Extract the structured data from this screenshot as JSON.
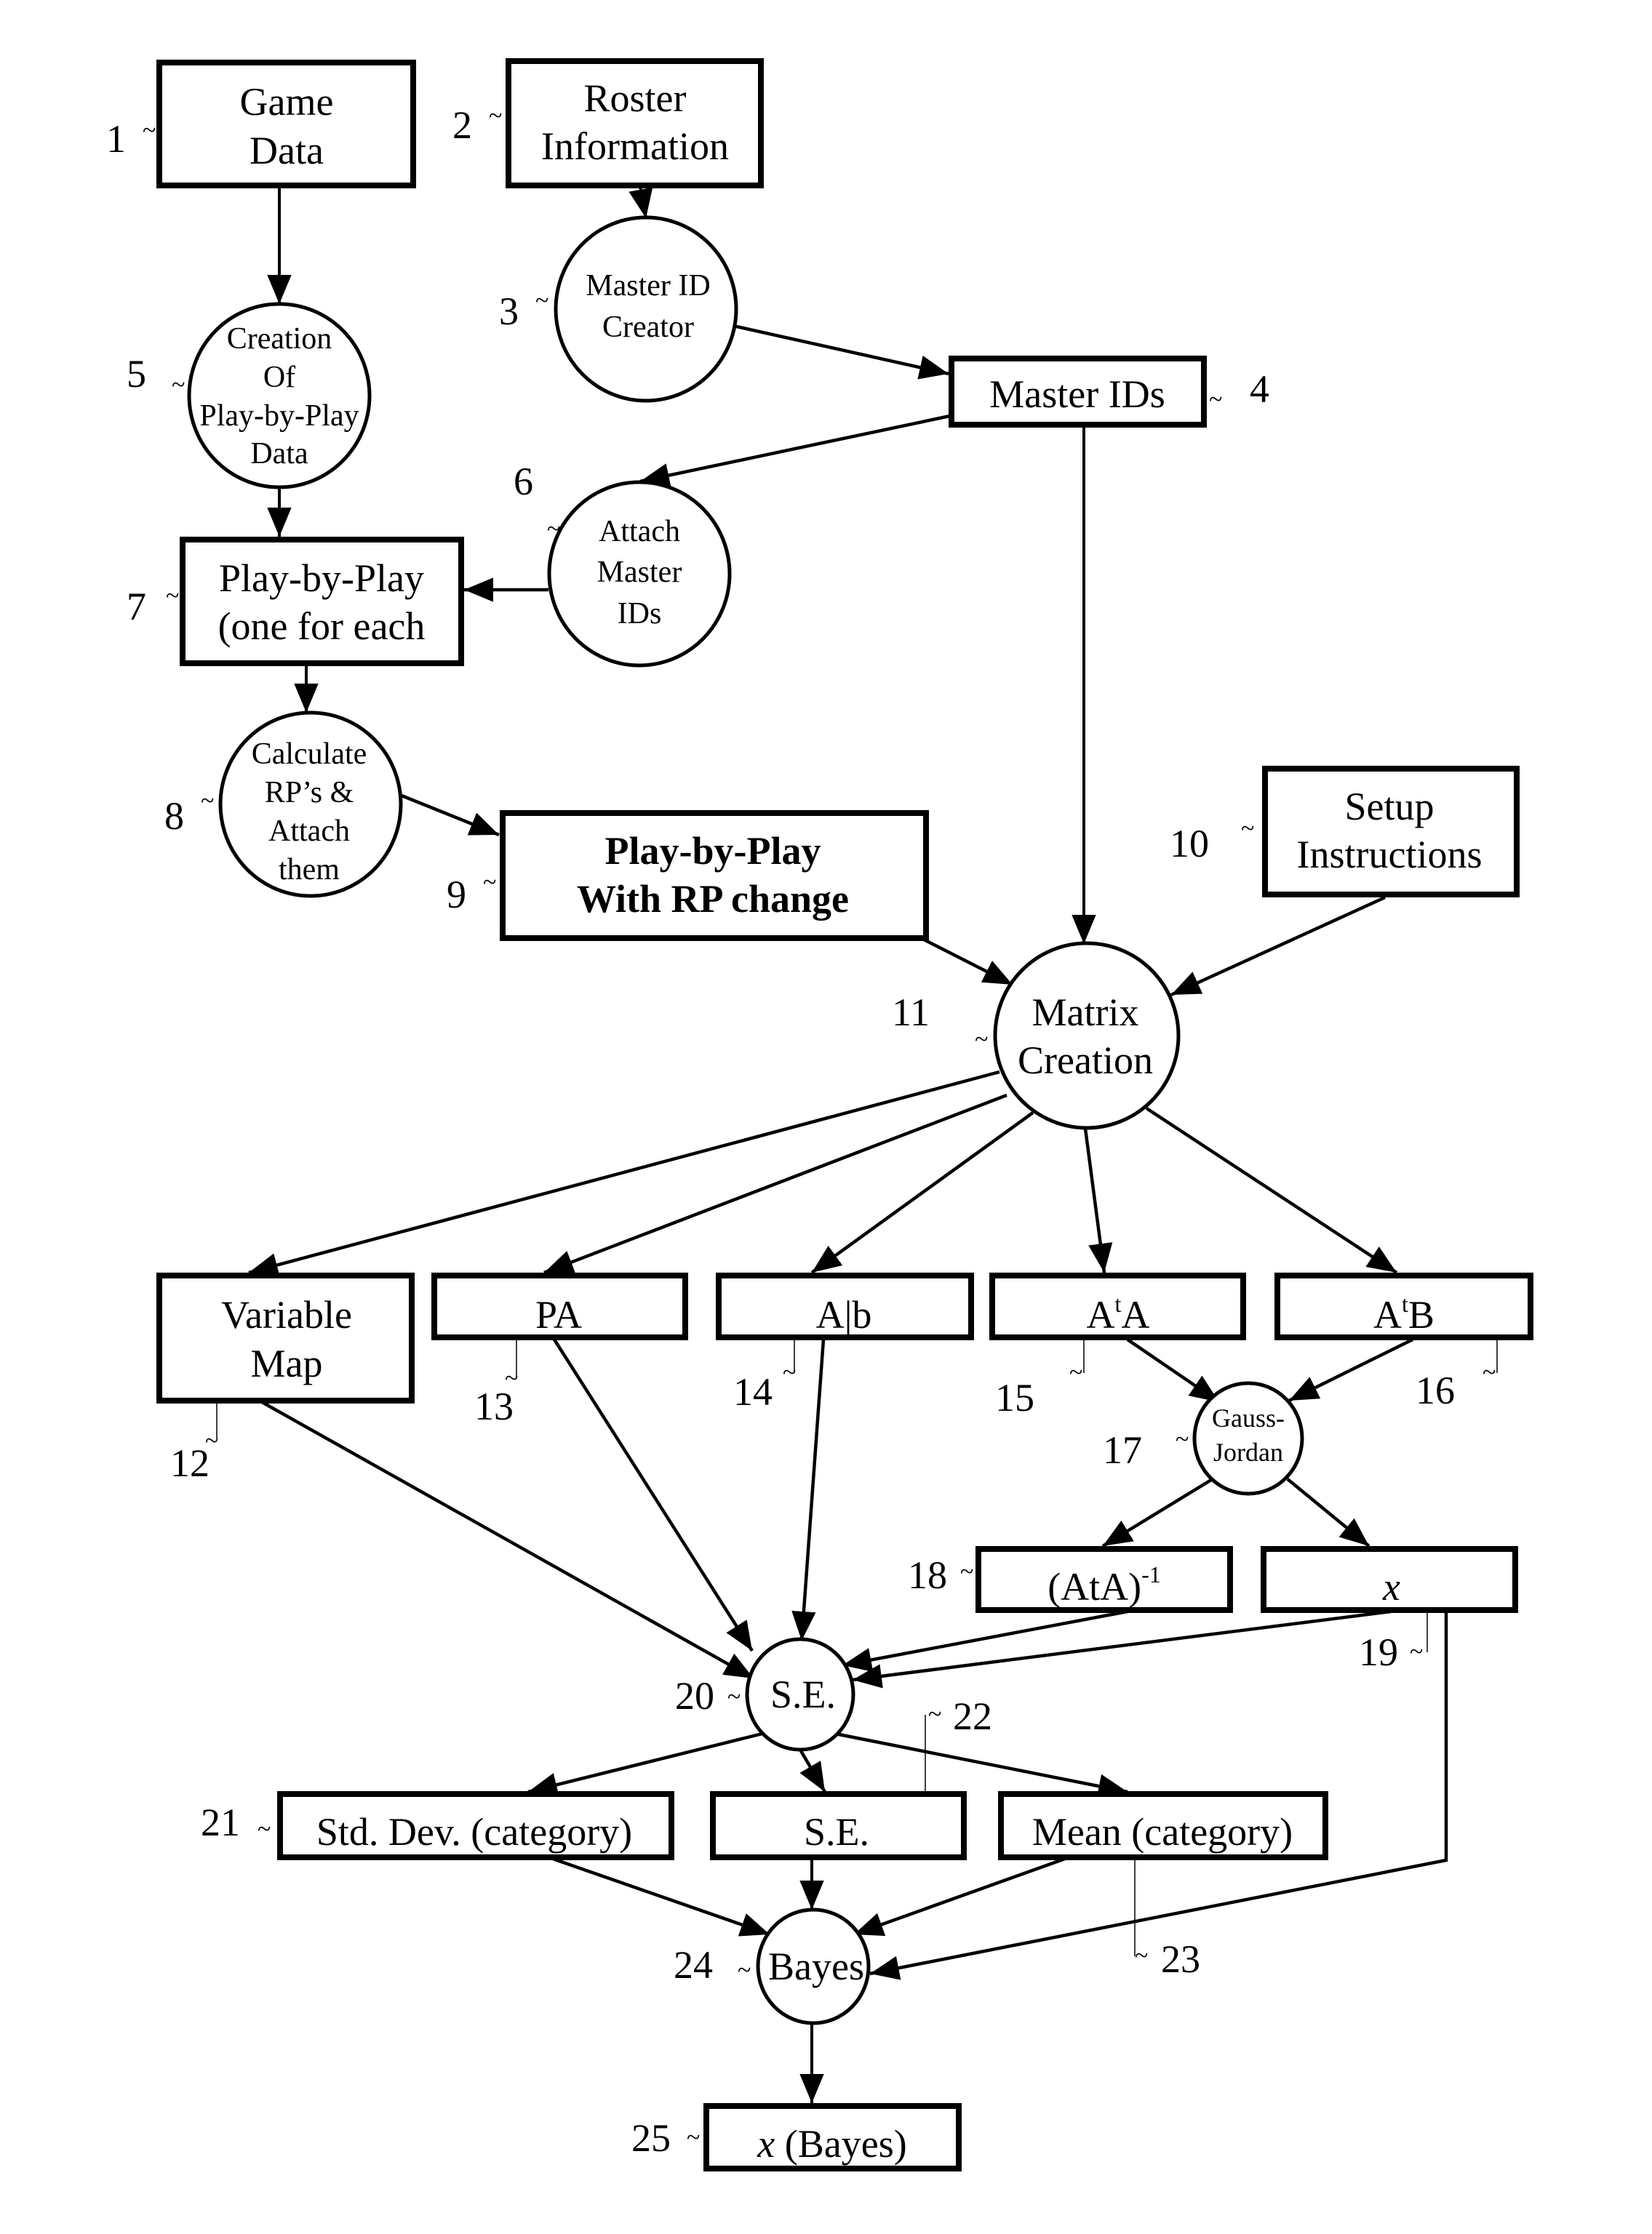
{
  "diagram": {
    "type": "flowchart",
    "colors": {
      "stroke": "#000000",
      "background": "#ffffff"
    },
    "nodes": [
      {
        "id": 1,
        "shape": "box",
        "lines": [
          "Game",
          "Data"
        ]
      },
      {
        "id": 2,
        "shape": "box",
        "lines": [
          "Roster",
          "Information"
        ]
      },
      {
        "id": 3,
        "shape": "circle",
        "lines": [
          "Master ID",
          "Creator"
        ]
      },
      {
        "id": 4,
        "shape": "box",
        "lines": [
          "Master IDs"
        ]
      },
      {
        "id": 5,
        "shape": "circle",
        "lines": [
          "Creation",
          "Of",
          "Play-by-Play",
          "Data"
        ]
      },
      {
        "id": 6,
        "shape": "circle",
        "lines": [
          "Attach",
          "Master",
          "IDs"
        ]
      },
      {
        "id": 7,
        "shape": "box",
        "lines": [
          "Play-by-Play",
          "(one for each"
        ]
      },
      {
        "id": 8,
        "shape": "circle",
        "lines": [
          "Calculate",
          "RP’s &",
          "Attach",
          "them"
        ]
      },
      {
        "id": 9,
        "shape": "box",
        "bold": true,
        "lines": [
          "Play-by-Play",
          "With RP change"
        ]
      },
      {
        "id": 10,
        "shape": "box",
        "lines": [
          "Setup",
          "Instructions"
        ]
      },
      {
        "id": 11,
        "shape": "circle",
        "lines": [
          "Matrix",
          "Creation"
        ]
      },
      {
        "id": 12,
        "shape": "box",
        "lines": [
          "Variable",
          "Map"
        ]
      },
      {
        "id": 13,
        "shape": "box",
        "lines": [
          "PA"
        ]
      },
      {
        "id": 14,
        "shape": "box",
        "lines": [
          "A|b"
        ]
      },
      {
        "id": 15,
        "shape": "box",
        "base": "A",
        "sup": "t",
        "tail": "A"
      },
      {
        "id": 16,
        "shape": "box",
        "base": "A",
        "sup": "t",
        "tail": "B"
      },
      {
        "id": 17,
        "shape": "circle",
        "lines": [
          "Gauss-",
          "Jordan"
        ]
      },
      {
        "id": 18,
        "shape": "box",
        "base": "(AtA)",
        "sup": "-1",
        "tail": ""
      },
      {
        "id": 19,
        "shape": "box",
        "italic": "x"
      },
      {
        "id": 20,
        "shape": "circle",
        "lines": [
          "S.E."
        ]
      },
      {
        "id": 21,
        "shape": "box",
        "lines": [
          "Std. Dev. (category)"
        ]
      },
      {
        "id": 22,
        "shape": "box",
        "lines": [
          "S.E."
        ]
      },
      {
        "id": 23,
        "shape": "box",
        "lines": [
          "Mean (category)"
        ]
      },
      {
        "id": 24,
        "shape": "circle",
        "lines": [
          "Bayes"
        ]
      },
      {
        "id": 25,
        "shape": "box",
        "italic": "x",
        "rest": " (Bayes)"
      }
    ],
    "edges": [
      [
        1,
        5
      ],
      [
        2,
        3
      ],
      [
        3,
        4
      ],
      [
        4,
        6
      ],
      [
        5,
        7
      ],
      [
        6,
        7
      ],
      [
        7,
        8
      ],
      [
        8,
        9
      ],
      [
        4,
        11
      ],
      [
        9,
        11
      ],
      [
        10,
        11
      ],
      [
        11,
        12
      ],
      [
        11,
        13
      ],
      [
        11,
        14
      ],
      [
        11,
        15
      ],
      [
        11,
        16
      ],
      [
        15,
        17
      ],
      [
        16,
        17
      ],
      [
        17,
        18
      ],
      [
        17,
        19
      ],
      [
        12,
        20
      ],
      [
        13,
        20
      ],
      [
        14,
        20
      ],
      [
        18,
        20
      ],
      [
        19,
        20
      ],
      [
        20,
        21
      ],
      [
        20,
        22
      ],
      [
        20,
        23
      ],
      [
        21,
        24
      ],
      [
        22,
        24
      ],
      [
        23,
        24
      ],
      [
        19,
        24
      ],
      [
        24,
        25
      ]
    ],
    "reference_numerals": [
      "1",
      "2",
      "3",
      "4",
      "5",
      "6",
      "7",
      "8",
      "9",
      "10",
      "11",
      "12",
      "13",
      "14",
      "15",
      "16",
      "17",
      "18",
      "19",
      "20",
      "21",
      "22",
      "23",
      "24",
      "25"
    ],
    "tilde": "~"
  }
}
